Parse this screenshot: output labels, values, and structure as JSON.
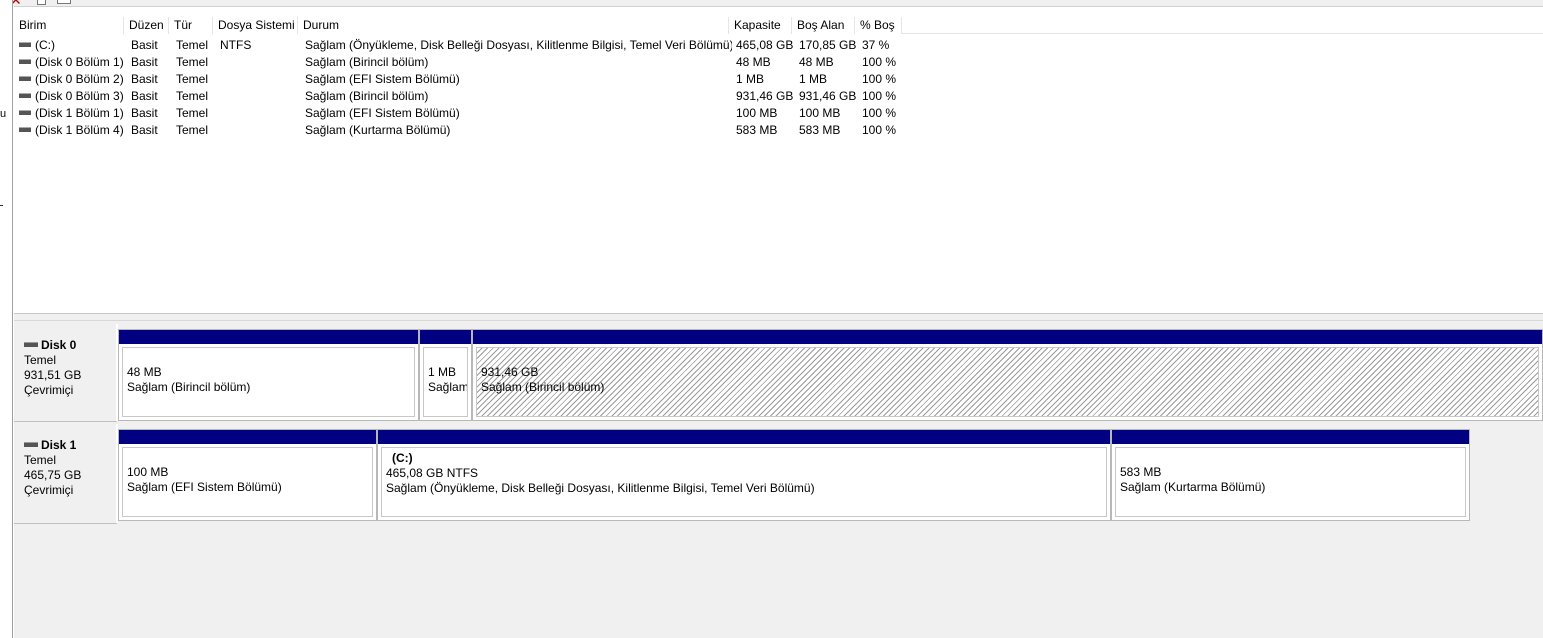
{
  "columns": [
    "Birim",
    "Düzen",
    "Tür",
    "Dosya Sistemi",
    "Durum",
    "Kapasite",
    "Boş Alan",
    "% Boş"
  ],
  "volumes": [
    {
      "name": "(C:)",
      "layout": "Basit",
      "type": "Temel",
      "fs": "NTFS",
      "status": "Sağlam (Önyükleme, Disk Belleği Dosyası, Kilitlenme Bilgisi, Temel Veri Bölümü)",
      "capacity": "465,08 GB",
      "free": "170,85 GB",
      "pct": "37 %"
    },
    {
      "name": "(Disk 0 Bölüm 1)",
      "layout": "Basit",
      "type": "Temel",
      "fs": "",
      "status": "Sağlam (Birincil bölüm)",
      "capacity": "48 MB",
      "free": "48 MB",
      "pct": "100 %"
    },
    {
      "name": "(Disk 0 Bölüm 2)",
      "layout": "Basit",
      "type": "Temel",
      "fs": "",
      "status": "Sağlam (EFI Sistem Bölümü)",
      "capacity": "1 MB",
      "free": "1 MB",
      "pct": "100 %"
    },
    {
      "name": "(Disk 0 Bölüm 3)",
      "layout": "Basit",
      "type": "Temel",
      "fs": "",
      "status": "Sağlam (Birincil bölüm)",
      "capacity": "931,46 GB",
      "free": "931,46 GB",
      "pct": "100 %"
    },
    {
      "name": "(Disk 1 Bölüm 1)",
      "layout": "Basit",
      "type": "Temel",
      "fs": "",
      "status": "Sağlam (EFI Sistem Bölümü)",
      "capacity": "100 MB",
      "free": "100 MB",
      "pct": "100 %"
    },
    {
      "name": "(Disk 1 Bölüm 4)",
      "layout": "Basit",
      "type": "Temel",
      "fs": "",
      "status": "Sağlam (Kurtarma Bölümü)",
      "capacity": "583 MB",
      "free": "583 MB",
      "pct": "100 %"
    }
  ],
  "disks": [
    {
      "name": "Disk 0",
      "type": "Temel",
      "size": "931,51 GB",
      "state": "Çevrimiçi",
      "partitions": [
        {
          "title": "",
          "size": "48 MB",
          "status": "Sağlam (Birincil bölüm)"
        },
        {
          "title": "",
          "size": "1 MB",
          "status": "Sağlam"
        },
        {
          "title": "",
          "size": "931,46 GB",
          "status": "Sağlam (Birincil bölüm)"
        }
      ]
    },
    {
      "name": "Disk 1",
      "type": "Temel",
      "size": "465,75 GB",
      "state": "Çevrimiçi",
      "partitions": [
        {
          "title": "",
          "size": "100 MB",
          "status": "Sağlam (EFI Sistem Bölümü)"
        },
        {
          "title": "(C:)",
          "size": "465,08 GB NTFS",
          "status": "Sağlam (Önyükleme, Disk Belleği Dosyası, Kilitlenme Bilgisi, Temel Veri Bölümü)"
        },
        {
          "title": "",
          "size": "583 MB",
          "status": "Sağlam (Kurtarma Bölümü)"
        }
      ]
    }
  ],
  "left_edge_char": "u",
  "colors": {
    "partition_bar": "#000080",
    "close_icon": "#c00000"
  }
}
